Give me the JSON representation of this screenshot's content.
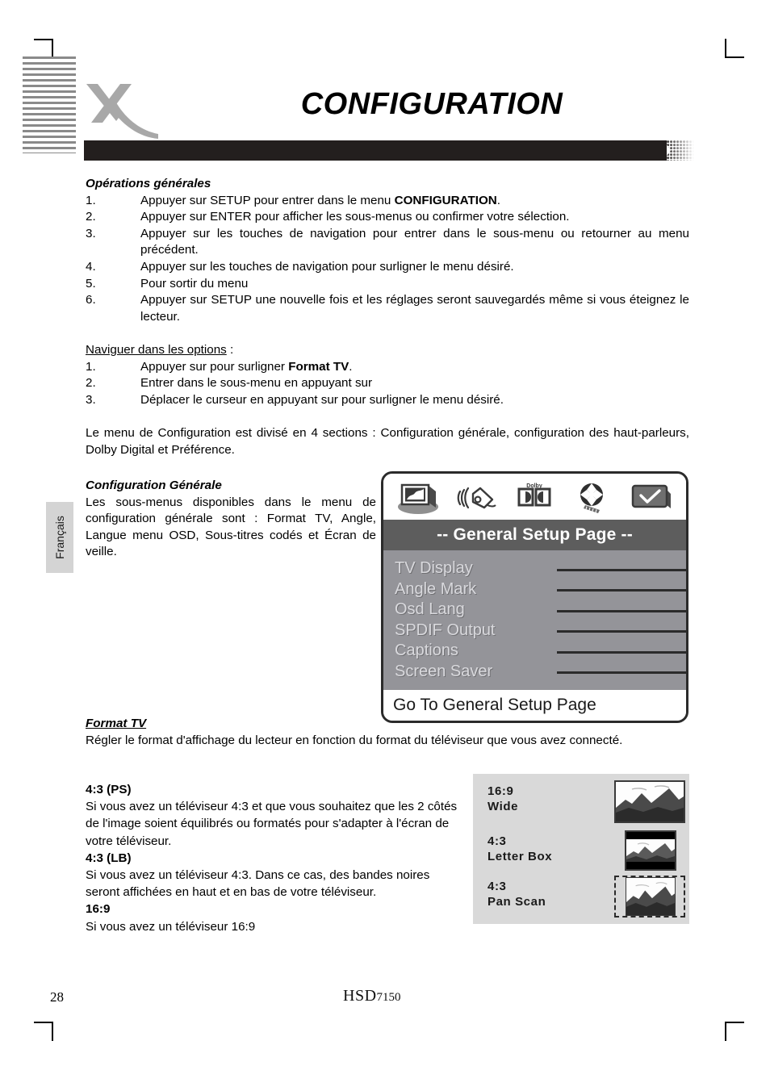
{
  "page": {
    "title": "CONFIGURATION",
    "number": "28",
    "model_mark": "HSD",
    "model_number": "7150",
    "language_tab": "Français"
  },
  "sections": {
    "general_ops": {
      "heading": "Opérations générales",
      "items": [
        {
          "num": "1.",
          "text": "Appuyer sur SETUP pour entrer dans le menu ",
          "bold": "CONFIGURATION",
          "tail": "."
        },
        {
          "num": "2.",
          "text": "Appuyer sur ENTER pour afficher les sous-menus ou confirmer votre sélection.",
          "bold": "",
          "tail": ""
        },
        {
          "num": "3.",
          "text": "Appuyer sur les touches de navigation pour entrer dans le sous-menu ou retourner au menu précédent.",
          "bold": "",
          "tail": ""
        },
        {
          "num": "4.",
          "text": "Appuyer sur les touches de navigation pour surligner le menu désiré.",
          "bold": "",
          "tail": ""
        },
        {
          "num": "5.",
          "text": "Pour sortir du menu",
          "bold": "",
          "tail": ""
        },
        {
          "num": "6.",
          "text": "Appuyer sur SETUP une nouvelle fois et les réglages seront sauvegardés même si vous éteignez le lecteur.",
          "bold": "",
          "tail": ""
        }
      ]
    },
    "navigate": {
      "heading": "Naviguer dans les options",
      "heading_suffix": " :",
      "items": [
        {
          "num": "1.",
          "text": "Appuyer sur  pour surligner ",
          "bold": "Format TV",
          "tail": "."
        },
        {
          "num": "2.",
          "text": "Entrer dans le sous-menu en appuyant sur",
          "bold": "",
          "tail": ""
        },
        {
          "num": "3.",
          "text": "Déplacer le curseur en appuyant sur  pour surligner le menu désiré.",
          "bold": "",
          "tail": ""
        }
      ]
    },
    "intro_paragraph": "Le menu de Configuration est divisé en 4 sections : Configuration générale, configuration des haut-parleurs, Dolby Digital et Préférence.",
    "config_generale": {
      "heading": "Configuration Générale",
      "paragraph": "Les sous-menus disponibles dans le menu de configuration générale sont : Format TV, Angle, Langue menu OSD, Sous-titres codés et Écran de veille."
    },
    "format_tv": {
      "heading": "Format TV",
      "paragraph": "Régler le format d'affichage du lecteur en fonction du format du téléviseur que vous avez connecté."
    },
    "aspect_explanations": [
      {
        "heading": "4:3 (PS)",
        "text": "Si vous avez un téléviseur 4:3 et que vous souhaitez que les 2 côtés de l'image soient équilibrés ou formatés pour s'adapter à l'écran de votre téléviseur."
      },
      {
        "heading": "4:3 (LB)",
        "text": "Si vous avez un téléviseur 4:3. Dans ce cas, des bandes noires seront affichées en haut et en bas de votre téléviseur."
      },
      {
        "heading": "16:9",
        "text": "Si vous avez un téléviseur 16:9"
      }
    ]
  },
  "osd": {
    "title": "-- General Setup Page --",
    "footer": "Go To General Setup Page",
    "icons": [
      {
        "name": "picture-icon",
        "label": "General Setup"
      },
      {
        "name": "speaker-icon",
        "label": "Speaker Setup"
      },
      {
        "name": "dolby-icon",
        "label": "Dolby Digital Setup"
      },
      {
        "name": "disc-icon",
        "label": "Preference"
      },
      {
        "name": "check-icon",
        "label": "Exit Setup"
      }
    ],
    "menu_items": [
      {
        "label": "TV Display",
        "value": ""
      },
      {
        "label": "Angle Mark",
        "value": ""
      },
      {
        "label": "Osd Lang",
        "value": ""
      },
      {
        "label": "SPDIF Output",
        "value": ""
      },
      {
        "label": "Captions",
        "value": ""
      },
      {
        "label": "Screen Saver",
        "value": ""
      }
    ]
  },
  "aspect_panel": {
    "rows": [
      {
        "ratio": "16:9",
        "mode": "Wide",
        "thumb": "full"
      },
      {
        "ratio": "4:3",
        "mode": "Letter Box",
        "thumb": "letterbox"
      },
      {
        "ratio": "4:3",
        "mode": "Pan Scan",
        "thumb": "panscan"
      }
    ]
  },
  "colors": {
    "header_bar": "#231f1e",
    "osd_title_bg": "#5d5d5d",
    "osd_list_bg": "#949499",
    "osd_label": "#d9d9dd",
    "aspect_panel_bg": "#d9d9d9",
    "logo_gray": "#a8a8a8",
    "lang_tab_bg": "#d4d4d4"
  }
}
